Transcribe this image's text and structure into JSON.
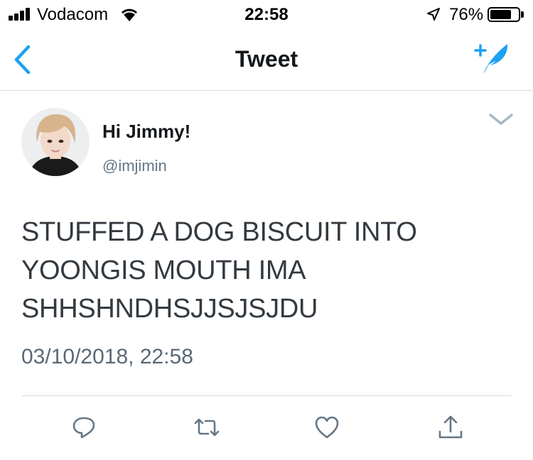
{
  "status_bar": {
    "carrier": "Vodacom",
    "time": "22:58",
    "battery_percent": "76%",
    "battery_level": 0.76,
    "icons": [
      "signal-icon",
      "wifi-icon",
      "location-arrow-icon",
      "battery-icon"
    ]
  },
  "nav": {
    "title": "Tweet",
    "back_icon": "chevron-left-icon",
    "compose_icon": "compose-tweet-icon"
  },
  "tweet": {
    "display_name": "Hi Jimmy!",
    "handle": "@imjimin",
    "text_lines": [
      "STUFFED A DOG BISCUIT INTO",
      "YOONGIS MOUTH IMA",
      "SHHSHNDHSJJSJSJDU"
    ],
    "timestamp": "03/10/2018, 22:58",
    "menu_icon": "chevron-down-icon"
  },
  "actions": [
    "reply-icon",
    "retweet-icon",
    "like-icon",
    "share-icon"
  ],
  "colors": {
    "accent": "#1DA1F2",
    "text": "#14171A",
    "secondary_text": "#657786",
    "icon_gray": "#657786",
    "divider": "#D8DBDE"
  }
}
